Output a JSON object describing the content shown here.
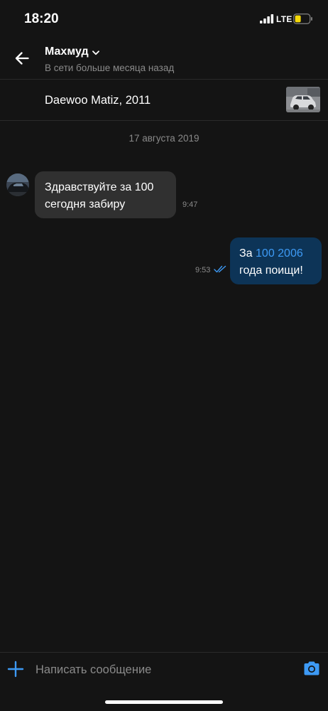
{
  "status_bar": {
    "time": "18:20",
    "network": "LTE",
    "battery_color": "#f5d90a"
  },
  "header": {
    "contact_name": "Махмуд",
    "contact_status": "В сети больше месяца назад"
  },
  "listing": {
    "title": "Daewoo Matiz, 2011"
  },
  "chat": {
    "date": "17 августа 2019",
    "messages": [
      {
        "direction": "incoming",
        "lines": [
          "Здравствуйте за 100",
          "сегодня забиру"
        ],
        "time": "9:47"
      },
      {
        "direction": "outgoing",
        "prefix": "За ",
        "link": "100 2006",
        "suffix": "года поищи!",
        "time": "9:53",
        "status": "read"
      }
    ]
  },
  "composer": {
    "placeholder": "Написать сообщение"
  },
  "colors": {
    "background": "#141414",
    "incoming_bubble": "#303030",
    "outgoing_bubble": "#0d3457",
    "accent": "#3d9af5",
    "secondary_text": "#8a8a8a"
  },
  "icons": [
    "signal-icon",
    "battery-icon",
    "back-arrow-icon",
    "chevron-down-icon",
    "double-check-icon",
    "plus-icon",
    "camera-icon"
  ]
}
